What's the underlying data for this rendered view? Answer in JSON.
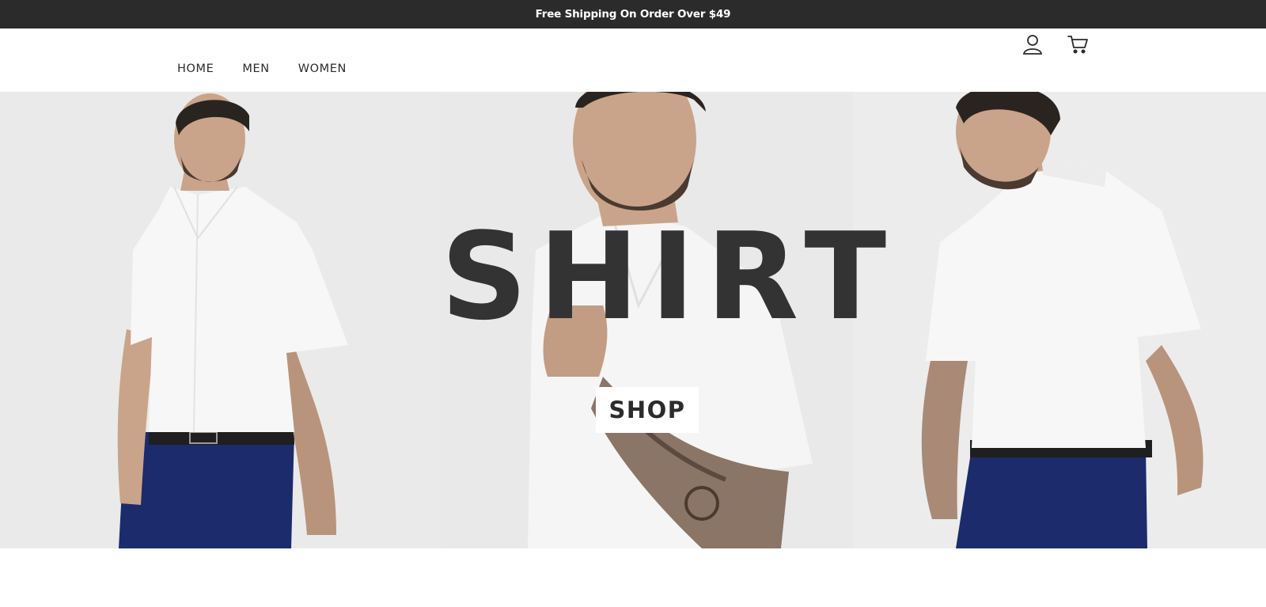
{
  "announcement": {
    "text": "Free Shipping On Order Over $49"
  },
  "nav": {
    "items": [
      "HOME",
      "MEN",
      "WOMEN"
    ]
  },
  "header_icons": {
    "account": "user-icon",
    "cart": "cart-icon"
  },
  "hero": {
    "title": "SHIRT",
    "cta_label": "SHOP"
  },
  "colors": {
    "topbar_bg": "#2b2b2b",
    "title_text": "#333333",
    "shirt": "#f7f7f7",
    "pants": "#1c2b6b",
    "skin": "#c9a48a"
  }
}
